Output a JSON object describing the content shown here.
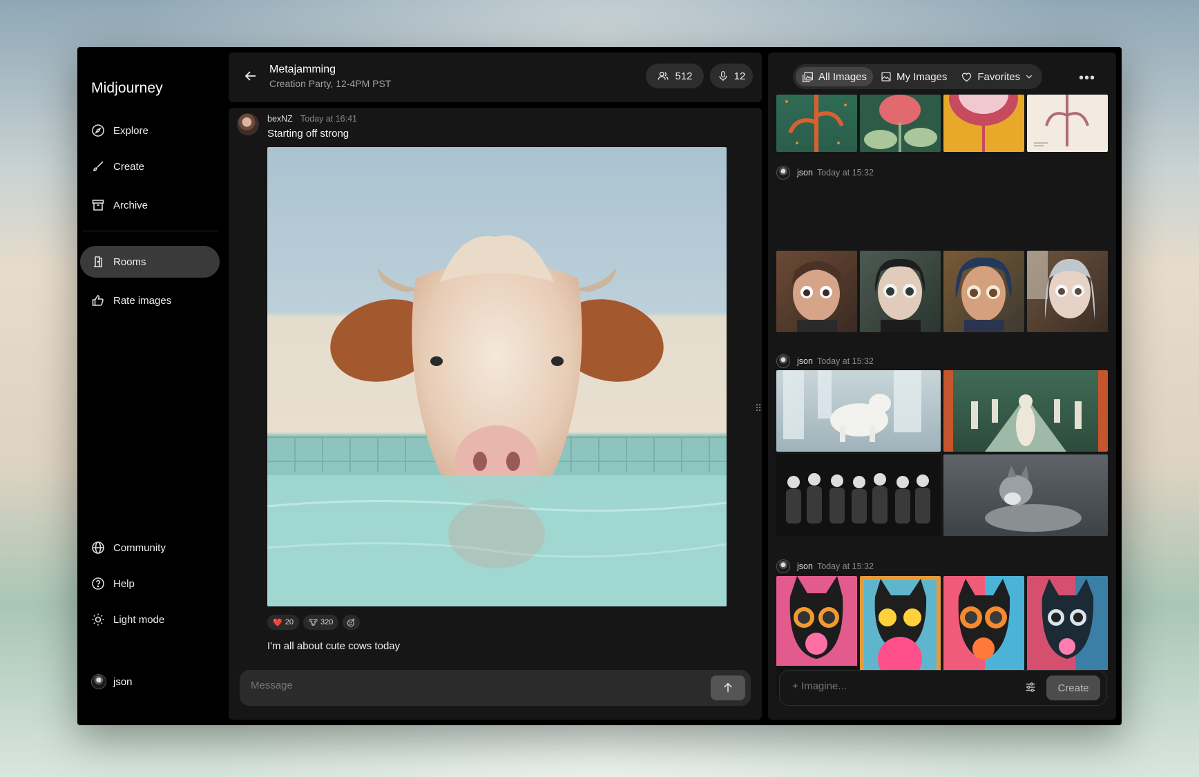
{
  "app": {
    "brand": "Midjourney"
  },
  "sidebar": {
    "items": [
      {
        "label": "Explore",
        "icon": "compass-icon"
      },
      {
        "label": "Create",
        "icon": "brush-icon"
      },
      {
        "label": "Archive",
        "icon": "archive-icon"
      },
      {
        "label": "Rooms",
        "icon": "door-icon",
        "active": true
      },
      {
        "label": "Rate images",
        "icon": "thumbs-up-icon"
      }
    ],
    "bottom_items": [
      {
        "label": "Community",
        "icon": "globe-icon"
      },
      {
        "label": "Help",
        "icon": "help-icon"
      },
      {
        "label": "Light mode",
        "icon": "sun-icon"
      }
    ],
    "user": "json"
  },
  "room": {
    "title": "Metajamming",
    "subtitle": "Creation Party, 12-4PM PST",
    "members": "512",
    "speakers": "12"
  },
  "chat": {
    "message": {
      "user": "bexNZ",
      "time": "Today at 16:41",
      "text": "Starting off strong",
      "reactions": [
        {
          "emoji": "❤️",
          "count": "20"
        },
        {
          "emoji": "🐮",
          "count": "320"
        }
      ],
      "followup": "I'm all about cute cows today"
    },
    "composer_placeholder": "Message"
  },
  "gallery": {
    "tabs": [
      {
        "label": "All Images",
        "active": true
      },
      {
        "label": "My Images"
      },
      {
        "label": "Favorites"
      }
    ],
    "posts": [
      {
        "user": "json",
        "time": "Today at 15:32"
      },
      {
        "user": "json",
        "time": "Today at 15:32"
      },
      {
        "user": "json",
        "time": "Today at 15:32"
      }
    ],
    "imagine_placeholder": "+ Imagine...",
    "create_label": "Create"
  },
  "colors": {
    "accent_heart": "#e53935",
    "panel": "#161616",
    "app_bg": "#000000"
  }
}
